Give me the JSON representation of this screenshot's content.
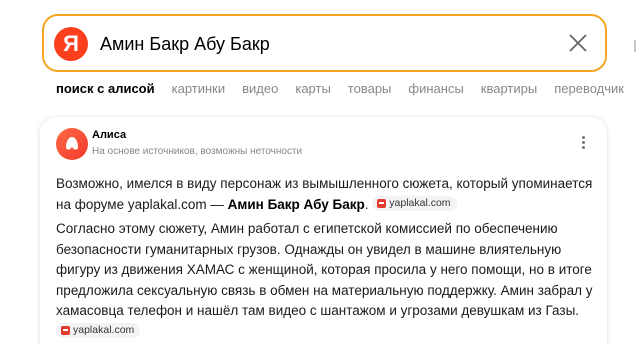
{
  "search": {
    "logo_letter": "Я",
    "query": "Амин Бакр Абу Бакр"
  },
  "tabs": [
    {
      "label": "поиск с алисой",
      "active": true
    },
    {
      "label": "картинки",
      "active": false
    },
    {
      "label": "видео",
      "active": false
    },
    {
      "label": "карты",
      "active": false
    },
    {
      "label": "товары",
      "active": false
    },
    {
      "label": "финансы",
      "active": false
    },
    {
      "label": "квартиры",
      "active": false
    },
    {
      "label": "переводчик",
      "active": false
    }
  ],
  "answer": {
    "title": "Алиса",
    "subtitle": "На основе источников, возможны неточности",
    "p1_text": "Возможно, имелся в виду персонаж из вымышленного сюжета, который упоминается на форуме yaplakal.com — ",
    "p1_bold": "Амин Бакр Абу Бакр",
    "p1_end": ".",
    "p2_text": "Согласно этому сюжету, Амин работал с египетской комиссией по обеспечению безопасности гуманитарных грузов. Однажды он увидел в машине влиятельную фигуру из движения ХАМАС с женщиной, которая просила у него помощи, но в итоге предложила сексуальную связь в обмен на материальную поддержку. Амин забрал у хамасовца телефон и нашёл там видео с шантажом и угрозами девушкам из Газы.",
    "source_label": "yaplakal.com"
  },
  "colors": {
    "accent_border": "#f5a623",
    "logo_red": "#fc3f1d"
  }
}
